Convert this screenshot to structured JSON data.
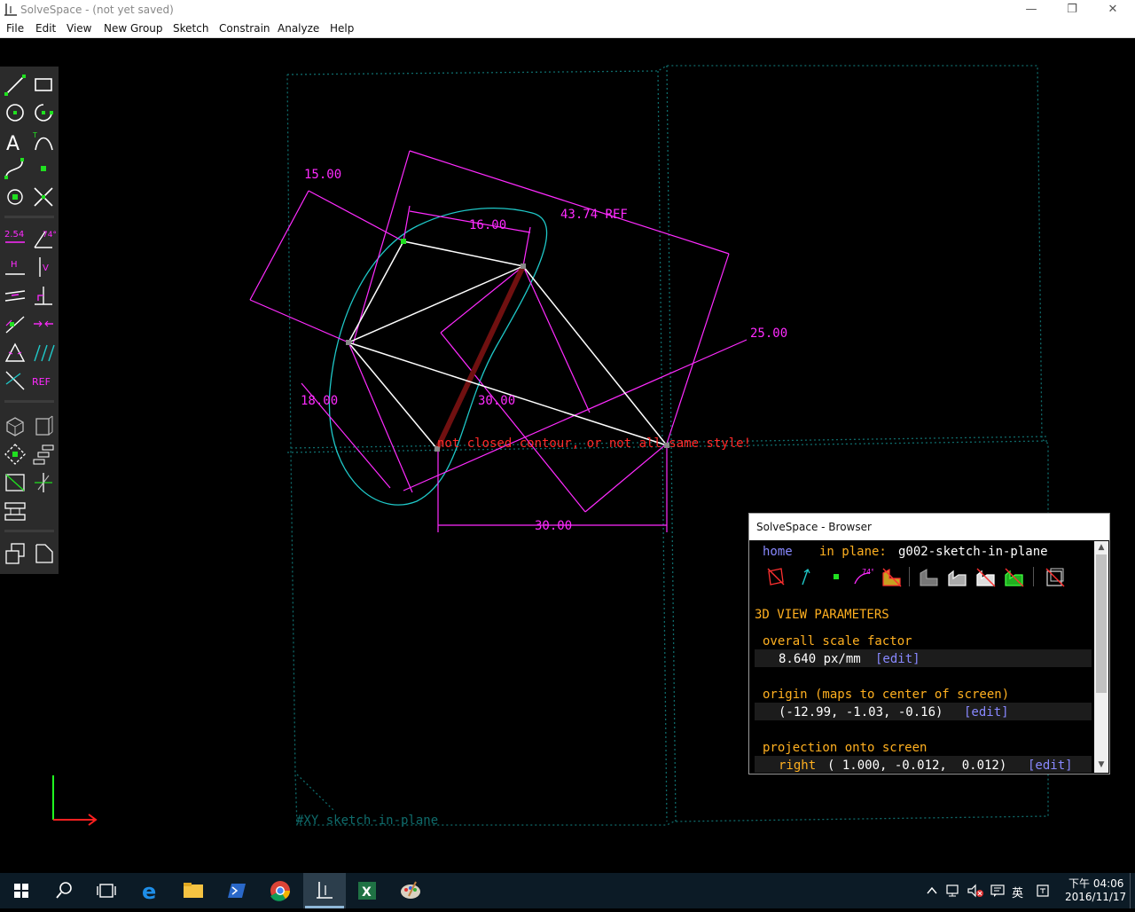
{
  "window": {
    "title": "SolveSpace - (not yet saved)",
    "minimize_glyph": "—",
    "restore_glyph": "❐",
    "close_glyph": "✕"
  },
  "menu": [
    "File",
    "Edit",
    "View",
    "New Group",
    "Sketch",
    "Constrain",
    "Analyze",
    "Help"
  ],
  "toolbar": {
    "rows": [
      [
        "line-segment-icon",
        "rectangle-icon"
      ],
      [
        "circle-icon",
        "arc-icon"
      ],
      [
        "text-icon",
        "tangent-arc-icon"
      ],
      [
        "cubic-spline-icon",
        "datum-point-icon"
      ],
      [
        "workplane-point-icon",
        "split-curves-icon"
      ],
      [
        "distance-dimension-icon",
        "angle-dimension-icon"
      ],
      [
        "horizontal-constraint-icon",
        "vertical-constraint-icon"
      ],
      [
        "parallel-constraint-icon",
        "perpendicular-constraint-icon"
      ],
      [
        "point-on-line-icon",
        "symmetric-constraint-icon"
      ],
      [
        "equal-length-icon",
        "other-supplementary-icon"
      ],
      [
        "construction-toggle-icon",
        "reference-toggle-icon"
      ],
      [
        "nearest-isometric-view-icon",
        "nearest-ortho-view-icon"
      ],
      [
        "workplane-center-icon",
        "step-translating-icon"
      ],
      [
        "step-rotating-icon",
        "extrude-icon"
      ],
      [
        "lathe-icon",
        null
      ],
      [
        "sketch-in-3d-icon",
        "sketch-in-new-workplane-icon"
      ]
    ],
    "labels": {
      "distance": "2.54",
      "angle": "74°",
      "horizontal": "H",
      "vertical": "V",
      "reference": "REF"
    }
  },
  "sketch": {
    "dimensions": {
      "d_15": "15.00",
      "d_16": "16.00",
      "d_4374": "43.74 REF",
      "d_25": "25.00",
      "d_18": "18.00",
      "d_30_diag": "30.00",
      "d_30_horiz": "30.00"
    },
    "error_text": "not closed contour, or not all same style!",
    "workplane_label": "#XY  sketch-in-plane",
    "colors": {
      "dimension": "#ff2bff",
      "entity": "#ffffff",
      "construction": "#1fc8c8",
      "error": "#ff2a2a",
      "bad_segment": "#701010",
      "point": "#20e020",
      "workplane": "#0f6b6b",
      "axis_x": "#ff2020",
      "axis_y": "#20ff20"
    }
  },
  "browser": {
    "title": "SolveSpace - Browser",
    "nav": {
      "home_link": "home",
      "in_plane_label": "in plane:",
      "group_name": "g002-sketch-in-plane"
    },
    "icons": [
      "hide-workplanes-icon",
      "show-normals-icon",
      "show-points-icon",
      "show-constraints-icon",
      "show-faces-icon",
      "shaded-solid-icon",
      "solid-edges-icon",
      "outline-icon",
      "hidden-lines-icon",
      "mesh-icon",
      "perspective-toggle-icon"
    ],
    "section_title": "3D VIEW PARAMETERS",
    "params": [
      {
        "label": "overall scale factor",
        "value": "8.640 px/mm",
        "edit": "[edit]"
      },
      {
        "label": "origin (maps to center of screen)",
        "value": "(-12.99, -1.03, -0.16)",
        "edit": "[edit]"
      },
      {
        "label": "projection onto screen",
        "value_prefix": "right",
        "value": "( 1.000, -0.012,  0.012)",
        "edit": "[edit]"
      }
    ]
  },
  "taskbar": {
    "apps": [
      "start-button",
      "search-icon",
      "task-view-icon",
      "edge-icon",
      "file-explorer-icon",
      "powershell-icon",
      "chrome-icon",
      "solvespace-icon",
      "excel-icon",
      "paint-icon"
    ],
    "tray": {
      "ime_label": "英",
      "time": "下午 04:06",
      "date": "2016/11/17"
    }
  }
}
